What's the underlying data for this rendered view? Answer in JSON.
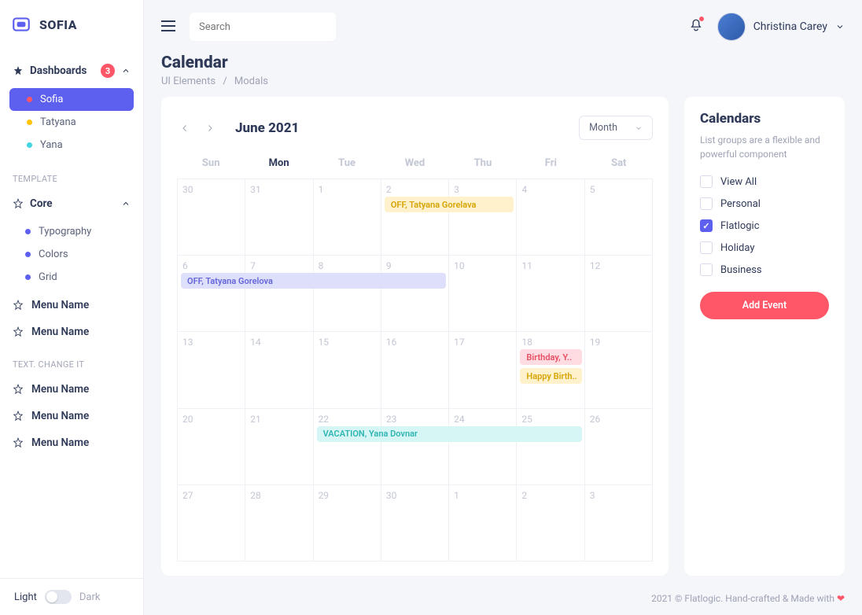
{
  "brand": "SOFIA",
  "sidebar": {
    "dashboards_label": "Dashboards",
    "dashboards_badge": "3",
    "items": [
      {
        "label": "Sofia",
        "color": "#ff5668",
        "active": true
      },
      {
        "label": "Tatyana",
        "color": "#ffc405",
        "active": false
      },
      {
        "label": "Yana",
        "color": "#41d5e2",
        "active": false
      }
    ],
    "section_template": "TEMPLATE",
    "core_label": "Core",
    "core_items": [
      {
        "label": "Typography"
      },
      {
        "label": "Colors"
      },
      {
        "label": "Grid"
      }
    ],
    "menu_items_1": [
      "Menu Name",
      "Menu Name"
    ],
    "section_text": "TEXT. CHANGE IT",
    "menu_items_2": [
      "Menu Name",
      "Menu Name",
      "Menu Name"
    ],
    "theme_light": "Light",
    "theme_dark": "Dark"
  },
  "search_placeholder": "Search",
  "user_name": "Christina Carey",
  "page": {
    "title": "Calendar",
    "crumb1": "UI Elements",
    "crumb2": "Modals"
  },
  "calendar": {
    "month_label": "June 2021",
    "view_label": "Month",
    "dow": [
      "Sun",
      "Mon",
      "Tue",
      "Wed",
      "Thu",
      "Fri",
      "Sat"
    ],
    "today_dow_index": 1,
    "days": [
      "30",
      "31",
      "1",
      "2",
      "3",
      "4",
      "5",
      "6",
      "7",
      "8",
      "9",
      "10",
      "11",
      "12",
      "13",
      "14",
      "15",
      "16",
      "17",
      "18",
      "19",
      "20",
      "21",
      "22",
      "23",
      "24",
      "25",
      "26",
      "27",
      "28",
      "29",
      "30",
      "1",
      "2",
      "3"
    ],
    "events": [
      {
        "label": "OFF, Tatyana Gorelava",
        "row": 0,
        "start": 3,
        "span": 2,
        "bg": "#fff1cc",
        "fg": "#d6a400",
        "slot": 0
      },
      {
        "label": "OFF, Tatyana Gorelova",
        "row": 1,
        "start": 0,
        "span": 4,
        "bg": "#dedffb",
        "fg": "#6366d9",
        "slot": 0
      },
      {
        "label": "Birthday, Y..",
        "row": 2,
        "start": 5,
        "span": 1,
        "bg": "#ffdce1",
        "fg": "#e74e62",
        "slot": 0
      },
      {
        "label": "Happy Birth..",
        "row": 2,
        "start": 5,
        "span": 1,
        "bg": "#fff1cc",
        "fg": "#d6a400",
        "slot": 1
      },
      {
        "label": "VACATION, Yana Dovnar",
        "row": 3,
        "start": 2,
        "span": 4,
        "bg": "#d5f6f5",
        "fg": "#2fb5b3",
        "slot": 0
      }
    ]
  },
  "side": {
    "title": "Calendars",
    "desc": "List groups are a flexible and powerful component",
    "filters": [
      {
        "label": "View All",
        "checked": false
      },
      {
        "label": "Personal",
        "checked": false
      },
      {
        "label": "Flatlogic",
        "checked": true
      },
      {
        "label": "Holiday",
        "checked": false
      },
      {
        "label": "Business",
        "checked": false
      }
    ],
    "add_label": "Add Event"
  },
  "footer": "2021 © Flatlogic. Hand-crafted & Made with "
}
